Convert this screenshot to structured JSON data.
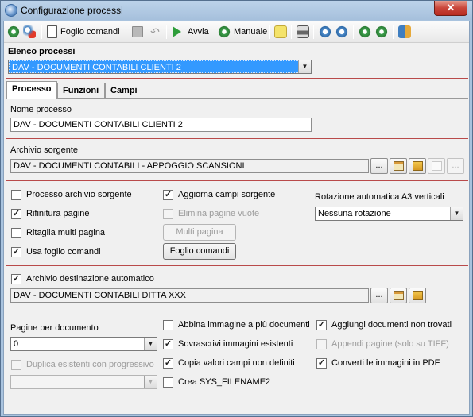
{
  "window": {
    "title": "Configurazione processi",
    "close_glyph": "✕"
  },
  "toolbar": {
    "foglio_comandi": "Foglio comandi",
    "avvia": "Avvia",
    "manuale": "Manuale"
  },
  "header": {
    "elenco_label": "Elenco processi",
    "elenco_value": "DAV - DOCUMENTI CONTABILI CLIENTI 2"
  },
  "tabs": [
    {
      "label": "Processo",
      "active": true
    },
    {
      "label": "Funzioni",
      "active": false
    },
    {
      "label": "Campi",
      "active": false
    }
  ],
  "processo": {
    "nome_label": "Nome processo",
    "nome_value": "DAV - DOCUMENTI CONTABILI CLIENTI 2",
    "archivio_label": "Archivio sorgente",
    "archivio_value": "DAV - DOCUMENTI CONTABILI - APPOGGIO SCANSIONI",
    "ellipsis": "...",
    "options": {
      "processo_archivio": {
        "label": "Processo archivio sorgente",
        "checked": false,
        "enabled": true
      },
      "rifinitura": {
        "label": "Rifinitura pagine",
        "checked": true,
        "enabled": true
      },
      "ritaglia": {
        "label": "Ritaglia multi pagina",
        "checked": false,
        "enabled": true
      },
      "usa_foglio": {
        "label": "Usa foglio comandi",
        "checked": true,
        "enabled": true
      },
      "aggiorna": {
        "label": "Aggiorna campi sorgente",
        "checked": true,
        "enabled": true
      },
      "elimina": {
        "label": "Elimina pagine vuote",
        "checked": false,
        "enabled": false
      }
    },
    "multi_pagina_btn": "Multi pagina",
    "foglio_comandi_btn": "Foglio comandi",
    "rotazione_label": "Rotazione automatica A3 verticali",
    "rotazione_value": "Nessuna rotazione",
    "dest_auto": {
      "label": "Archivio destinazione automatico",
      "checked": true
    },
    "dest_value": "DAV - DOCUMENTI CONTABILI DITTA XXX",
    "pagine_label": "Pagine per documento",
    "pagine_value": "0",
    "duplica": {
      "label": "Duplica esistenti con progressivo",
      "checked": false,
      "enabled": false
    },
    "duplica_value": "",
    "abbina": {
      "label": "Abbina immagine a più documenti",
      "checked": false
    },
    "sovrascrivi": {
      "label": "Sovrascrivi immagini esistenti",
      "checked": true
    },
    "copia": {
      "label": "Copia valori campi non definiti",
      "checked": true
    },
    "crea": {
      "label": "Crea SYS_FILENAME2",
      "checked": false
    },
    "aggiungi": {
      "label": "Aggiungi documenti non trovati",
      "checked": true
    },
    "appendi": {
      "label": "Appendi pagine (solo su TIFF)",
      "checked": false,
      "enabled": false
    },
    "converti": {
      "label": "Converti le immagini in PDF",
      "checked": true
    }
  },
  "icons": {
    "check": "✓",
    "dropdown": "▼",
    "undo": "↶"
  }
}
